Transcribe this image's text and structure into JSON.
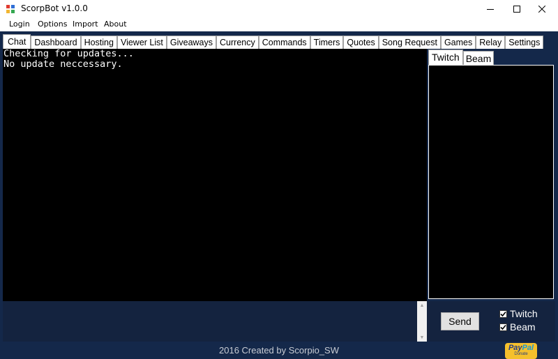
{
  "window": {
    "title": "ScorpBot v1.0.0",
    "controls": [
      "minimize-icon",
      "maximize-icon",
      "close-icon"
    ]
  },
  "menu": {
    "items": [
      "Login",
      "Options",
      "Import",
      "About"
    ]
  },
  "tabs": {
    "items": [
      "Chat",
      "Dashboard",
      "Hosting",
      "Viewer List",
      "Giveaways",
      "Currency",
      "Commands",
      "Timers",
      "Quotes",
      "Song Request",
      "Games",
      "Relay",
      "Settings"
    ],
    "active": "Chat"
  },
  "chat": {
    "lines": [
      "Checking for updates...",
      "No update neccessary."
    ],
    "input_value": ""
  },
  "right_tabs": {
    "items": [
      "Twitch",
      "Beam"
    ],
    "active": "Twitch"
  },
  "send": {
    "label": "Send"
  },
  "platforms": [
    {
      "label": "Twitch",
      "checked": true
    },
    {
      "label": "Beam",
      "checked": true
    }
  ],
  "footer": {
    "credit": "2016 Created by Scorpio_SW",
    "donate_logo": {
      "pay": "Pay",
      "pal": "Pal",
      "sub": "Donate"
    }
  },
  "colors": {
    "frame_navy": "#14284a",
    "panel_dark": "#14233f",
    "console_bg": "#000000",
    "console_text": "#ffffff",
    "paypal_yellow": "#f5c02c"
  }
}
